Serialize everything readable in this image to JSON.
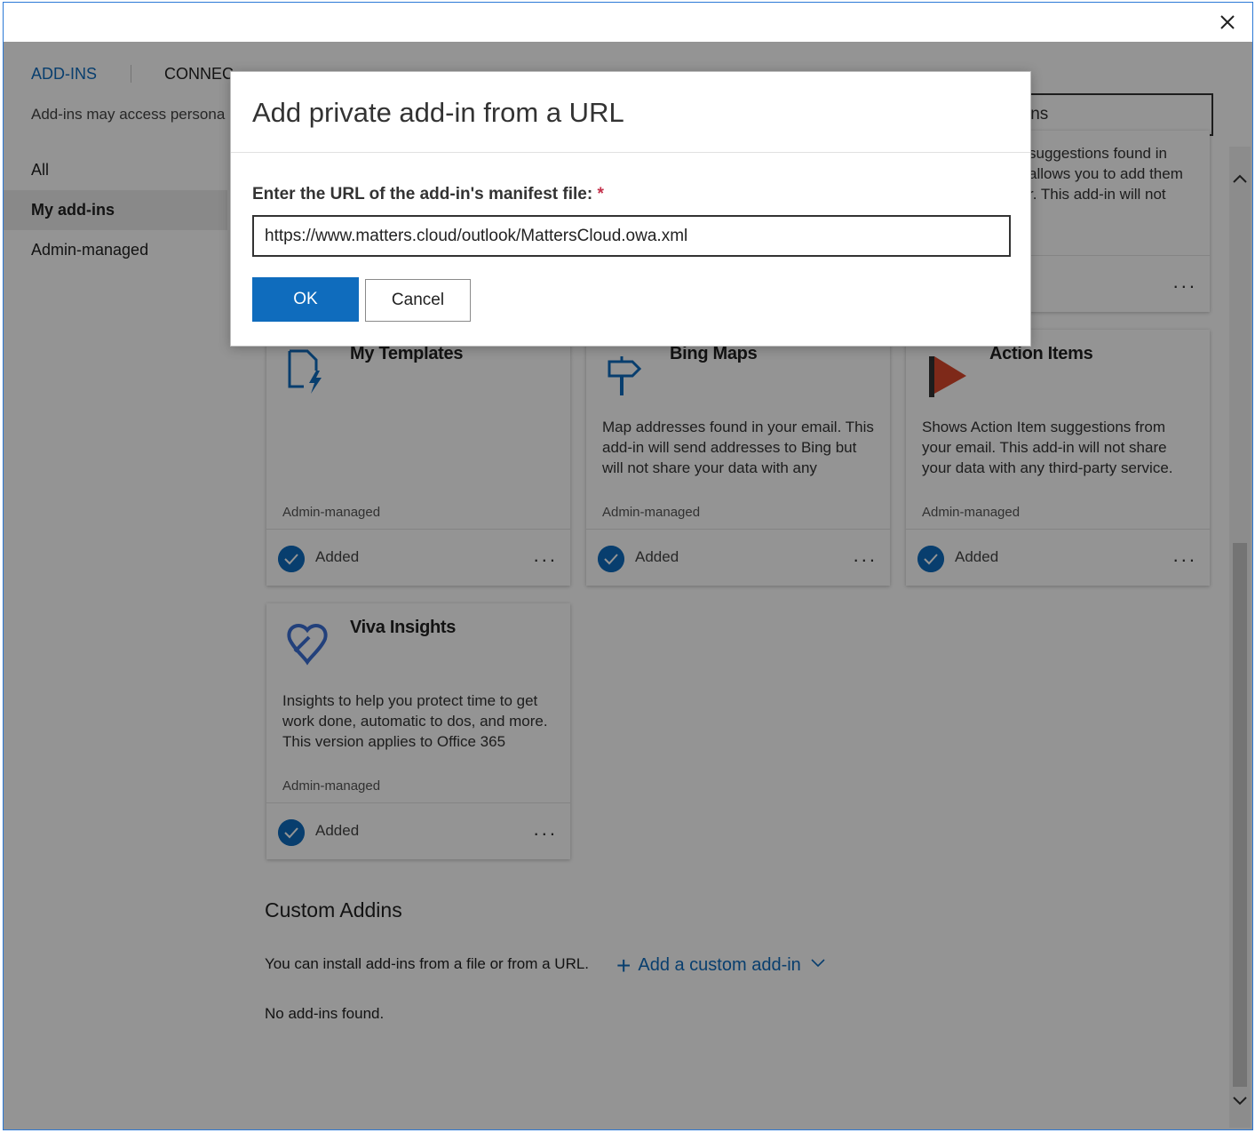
{
  "window": {
    "close_label": "×"
  },
  "tabs": {
    "addins": "ADD-INS",
    "connectors": "CONNEC"
  },
  "notice": "Add-ins may access persona",
  "nav": {
    "items": [
      "All",
      "My add-ins",
      "Admin-managed"
    ]
  },
  "search": {
    "visible_text": "ins"
  },
  "partial_card": {
    "desc_lines": [
      "suggestions found in",
      "allows you to add them",
      "r. This add-in will not"
    ]
  },
  "cards": [
    {
      "title": "My Templates",
      "icon": "document-lightning-icon",
      "description": "",
      "tag": "Admin-managed",
      "status": "Added",
      "more": "..."
    },
    {
      "title": "Bing Maps",
      "icon": "signpost-icon",
      "description": "Map addresses found in your email. This add-in will send addresses to Bing but will not share your data with any",
      "tag": "Admin-managed",
      "status": "Added",
      "more": "..."
    },
    {
      "title": "Action Items",
      "icon": "flag-icon",
      "description": "Shows Action Item suggestions from your email. This add-in will not share your data with any third-party service.",
      "tag": "Admin-managed",
      "status": "Added",
      "more": "..."
    },
    {
      "title": "Viva Insights",
      "icon": "viva-insights-icon",
      "description": "Insights to help you protect time to get work done, automatic to dos, and more. This version applies to Office 365",
      "tag": "Admin-managed",
      "status": "Added",
      "more": "..."
    }
  ],
  "custom": {
    "title": "Custom Addins",
    "note": "You can install add-ins from a file or from a URL.",
    "add_link": "Add a custom add-in",
    "empty": "No add-ins found."
  },
  "dialog": {
    "title": "Add private add-in from a URL",
    "label": "Enter the URL of the add-in's manifest file:",
    "required_mark": "*",
    "url_value": "https://www.matters.cloud/outlook/MattersCloud.owa.xml",
    "ok_label": "OK",
    "cancel_label": "Cancel"
  },
  "colors": {
    "accent": "#0f6cbd",
    "flag": "#d9472b",
    "required": "#c4314b"
  }
}
